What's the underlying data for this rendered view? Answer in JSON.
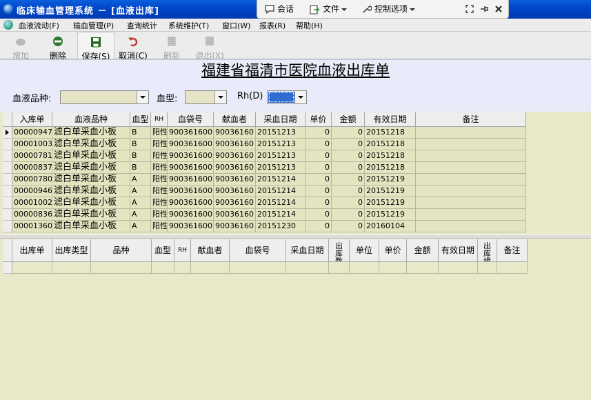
{
  "window": {
    "title": "临床输血管理系统 － [血液出库]"
  },
  "floatbar": {
    "chat": "会话",
    "file": "文件",
    "control": "控制选项"
  },
  "menu": [
    "血液流动(F)",
    "输血管理(P)",
    "查询统计",
    "系统维护(T)",
    "窗口(W)",
    "报表(R)",
    "帮助(H)"
  ],
  "toolbar": {
    "add": "增加",
    "delete": "删除",
    "save": "保存(S)",
    "cancel": "取消(C)",
    "refresh": "刷新",
    "exit": "退出(X)"
  },
  "form": {
    "title": "福建省福清市医院血液出库单",
    "blood_type_label": "血液品种:",
    "abo_label": "血型:",
    "rh_label": "Rh(D)",
    "blood_type_value": "",
    "abo_value": ""
  },
  "grid1": {
    "headers": [
      "入库单",
      "血液品种",
      "血型",
      "RH",
      "血袋号",
      "献血者",
      "采血日期",
      "单价",
      "金额",
      "有效日期",
      "备注"
    ],
    "rows": [
      [
        "00000947",
        "滤白单采血小板",
        "B",
        "阳性",
        "900361600",
        "90036160",
        "20151213",
        "0",
        "0",
        "20151218",
        ""
      ],
      [
        "00001003",
        "滤白单采血小板",
        "B",
        "阳性",
        "900361600",
        "90036160",
        "20151213",
        "0",
        "0",
        "20151218",
        ""
      ],
      [
        "00000781",
        "滤白单采血小板",
        "B",
        "阳性",
        "900361600",
        "90036160",
        "20151213",
        "0",
        "0",
        "20151218",
        ""
      ],
      [
        "00000837",
        "滤白单采血小板",
        "B",
        "阳性",
        "900361600",
        "90036160",
        "20151213",
        "0",
        "0",
        "20151218",
        ""
      ],
      [
        "00000780",
        "滤白单采血小板",
        "A",
        "阳性",
        "900361600",
        "90036160",
        "20151214",
        "0",
        "0",
        "20151219",
        ""
      ],
      [
        "00000946",
        "滤白单采血小板",
        "A",
        "阳性",
        "900361600",
        "90036160",
        "20151214",
        "0",
        "0",
        "20151219",
        ""
      ],
      [
        "00001002",
        "滤白单采血小板",
        "A",
        "阳性",
        "900361600",
        "90036160",
        "20151214",
        "0",
        "0",
        "20151219",
        ""
      ],
      [
        "00000836",
        "滤白单采血小板",
        "A",
        "阳性",
        "900361600",
        "90036160",
        "20151214",
        "0",
        "0",
        "20151219",
        ""
      ],
      [
        "00001360",
        "滤白单采血小板",
        "A",
        "阳性",
        "900361600",
        "90036160",
        "20151230",
        "0",
        "0",
        "20160104",
        ""
      ]
    ]
  },
  "grid2": {
    "headers": [
      "出库单",
      "出库类型",
      "品种",
      "血型",
      "RH",
      "献血者",
      "血袋号",
      "采血日期",
      "出库数量",
      "单位",
      "单价",
      "金额",
      "有效日期",
      "出库缘由",
      "备注"
    ]
  }
}
